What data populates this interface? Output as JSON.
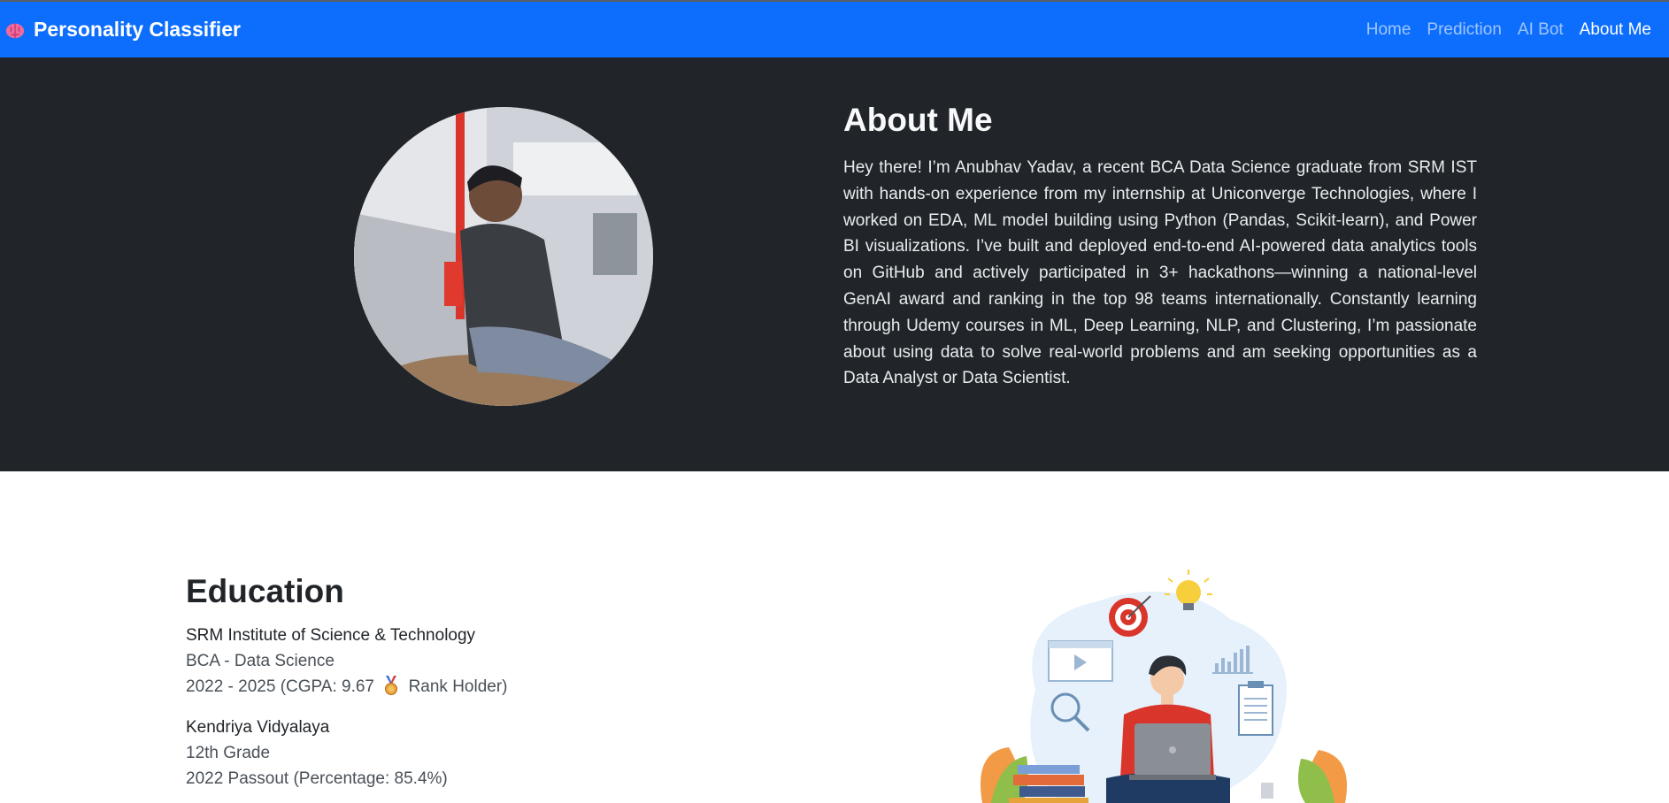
{
  "navbar": {
    "brand": "Personality Classifier",
    "brand_icon": "brain-icon",
    "links": [
      {
        "label": "Home",
        "active": false
      },
      {
        "label": "Prediction",
        "active": false
      },
      {
        "label": "AI Bot",
        "active": false
      },
      {
        "label": "About Me",
        "active": true
      }
    ]
  },
  "about": {
    "title": "About Me",
    "text": "Hey there! I’m Anubhav Yadav, a recent BCA Data Science graduate from SRM IST with hands-on experience from my internship at Uniconverge Technologies, where I worked on EDA, ML model building using Python (Pandas, Scikit-learn), and Power BI visualizations. I’ve built and deployed end-to-end AI-powered data analytics tools on GitHub and actively participated in 3+ hackathons—winning a national-level GenAI award and ranking in the top 98 teams internationally. Constantly learning through Udemy courses in ML, Deep Learning, NLP, and Clustering, I’m passionate about using data to solve real-world problems and am seeking opportunities as a Data Analyst or Data Scientist."
  },
  "education": {
    "title": "Education",
    "entries": [
      {
        "school": "SRM Institute of Science & Technology",
        "degree": "BCA - Data Science",
        "period_pre": "2022 - 2025 (CGPA: 9.67",
        "period_post": "Rank Holder)",
        "icon": "medal-icon"
      },
      {
        "school": "Kendriya Vidyalaya",
        "degree": "12th Grade",
        "period": "2022 Passout (Percentage: 85.4%)"
      }
    ]
  },
  "colors": {
    "navbar": "#0d6efd",
    "hero_bg": "#212529",
    "page_bg": "#ffffff"
  }
}
